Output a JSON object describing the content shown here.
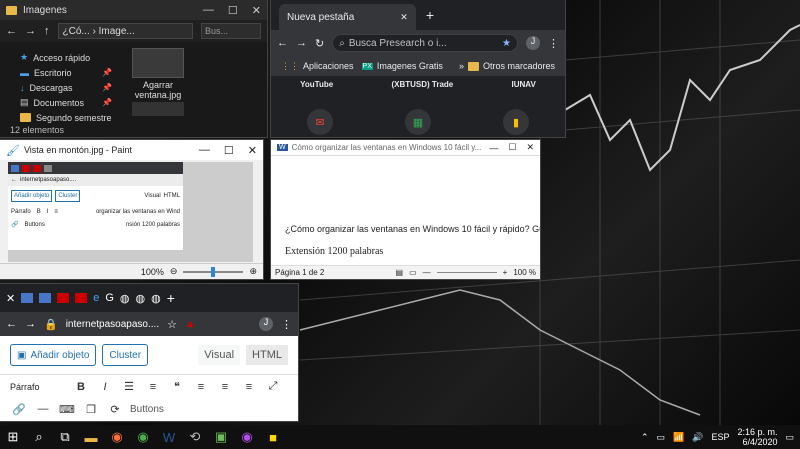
{
  "explorer": {
    "title": "Imagenes",
    "address": "¿Có... › Image...",
    "search_placeholder": "Bus...",
    "nav_items": [
      {
        "label": "Acceso rápido",
        "icon": "star-icon"
      },
      {
        "label": "Escritorio",
        "icon": "desktop-icon"
      },
      {
        "label": "Descargas",
        "icon": "download-icon"
      },
      {
        "label": "Documentos",
        "icon": "documents-icon"
      },
      {
        "label": "Segundo semestre",
        "icon": "folder-icon"
      }
    ],
    "file_name": "Agarrar ventana.jpg",
    "status": "12 elementos"
  },
  "chrome_top": {
    "tab_title": "Nueva pestaña",
    "omnibox": "Busca Presearch o i...",
    "avatar": "J",
    "bookmarks": [
      "Aplicaciones",
      "Imagenes Gratis",
      "Otros marcadores"
    ],
    "shortcuts_labels": [
      "YouTube",
      "(XBTUSD) Trade",
      "IUNAV"
    ]
  },
  "paint": {
    "title": "Vista en montón.jpg - Paint",
    "zoom": "100%",
    "inner": {
      "url": "internetpasoapaso....",
      "add_object": "Añadir objeto",
      "cluster": "Cluster",
      "visual": "Visual",
      "html": "HTML",
      "parrafo": "Párrafo",
      "buttons": "Buttons",
      "doc_text": "organizar las ventanas en Wind",
      "doc_text2": "nsión 1200 palabras"
    }
  },
  "word": {
    "title": "Cómo organizar las ventanas en Windows 10 fácil y...",
    "heading": "¿Cómo organizar las ventanas en Windows 10 fácil y rápido? Guía pas",
    "body": "Extensión 1200 palabras",
    "page_status": "Página 1 de 2",
    "zoom": "100 %"
  },
  "chrome_bottom": {
    "url": "internetpasoapaso....",
    "avatar": "J",
    "add_object": "Añadir objeto",
    "cluster": "Cluster",
    "visual": "Visual",
    "html": "HTML",
    "parrafo": "Párrafo",
    "buttons": "Buttons"
  },
  "taskbar": {
    "time": "2:16 p. m.",
    "date": "6/4/2020",
    "lang": "ESP"
  },
  "colors": {
    "wp_blue": "#2271b1",
    "chrome_dark": "#202124",
    "taskbar": "#101010"
  }
}
